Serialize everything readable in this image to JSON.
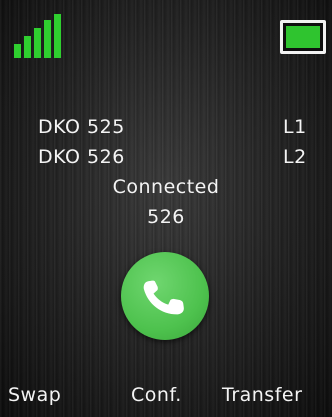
{
  "status_bar": {
    "signal_icon": "signal-strength-icon",
    "signal_bars": 5,
    "battery_icon": "battery-full-icon",
    "battery_level": 1.0,
    "accent_color": "#2fcf2f"
  },
  "calls": [
    {
      "name": "DKO 525",
      "line": "L1"
    },
    {
      "name": "DKO 526",
      "line": "L2"
    }
  ],
  "call_status": {
    "state": "Connected",
    "number": "526"
  },
  "call_button": {
    "icon": "phone-handset-icon",
    "color": "#4ec24e"
  },
  "softkeys": {
    "left": "Swap",
    "middle": "Conf.",
    "right": "Transfer"
  }
}
